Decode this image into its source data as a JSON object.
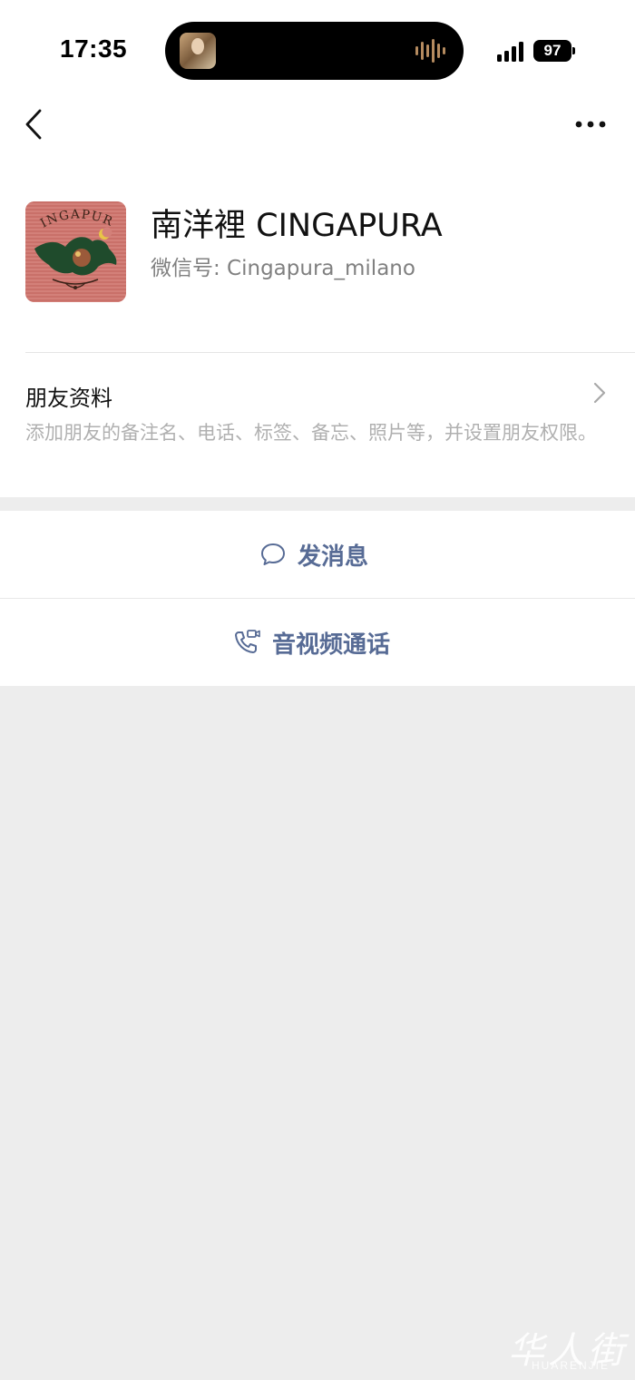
{
  "status_bar": {
    "time": "17:35",
    "battery": "97"
  },
  "nav": {
    "back_icon": "chevron-left-icon",
    "more_icon": "ellipsis-icon"
  },
  "profile": {
    "name": "南洋裡 CINGAPURA",
    "wechat_id": "微信号: Cingapura_milano",
    "avatar_text": "CINGAPURA",
    "avatar_color": "#d38079"
  },
  "friend_profile": {
    "title": "朋友资料",
    "description": "添加朋友的备注名、电话、标签、备忘、照片等，并设置朋友权限。"
  },
  "actions": {
    "send_message": "发消息",
    "av_call": "音视频通话"
  },
  "colors": {
    "link_blue": "#576b95",
    "background_grey": "#ededed"
  },
  "watermark": {
    "chinese": "华人街",
    "latin": "HUARENJIE"
  }
}
